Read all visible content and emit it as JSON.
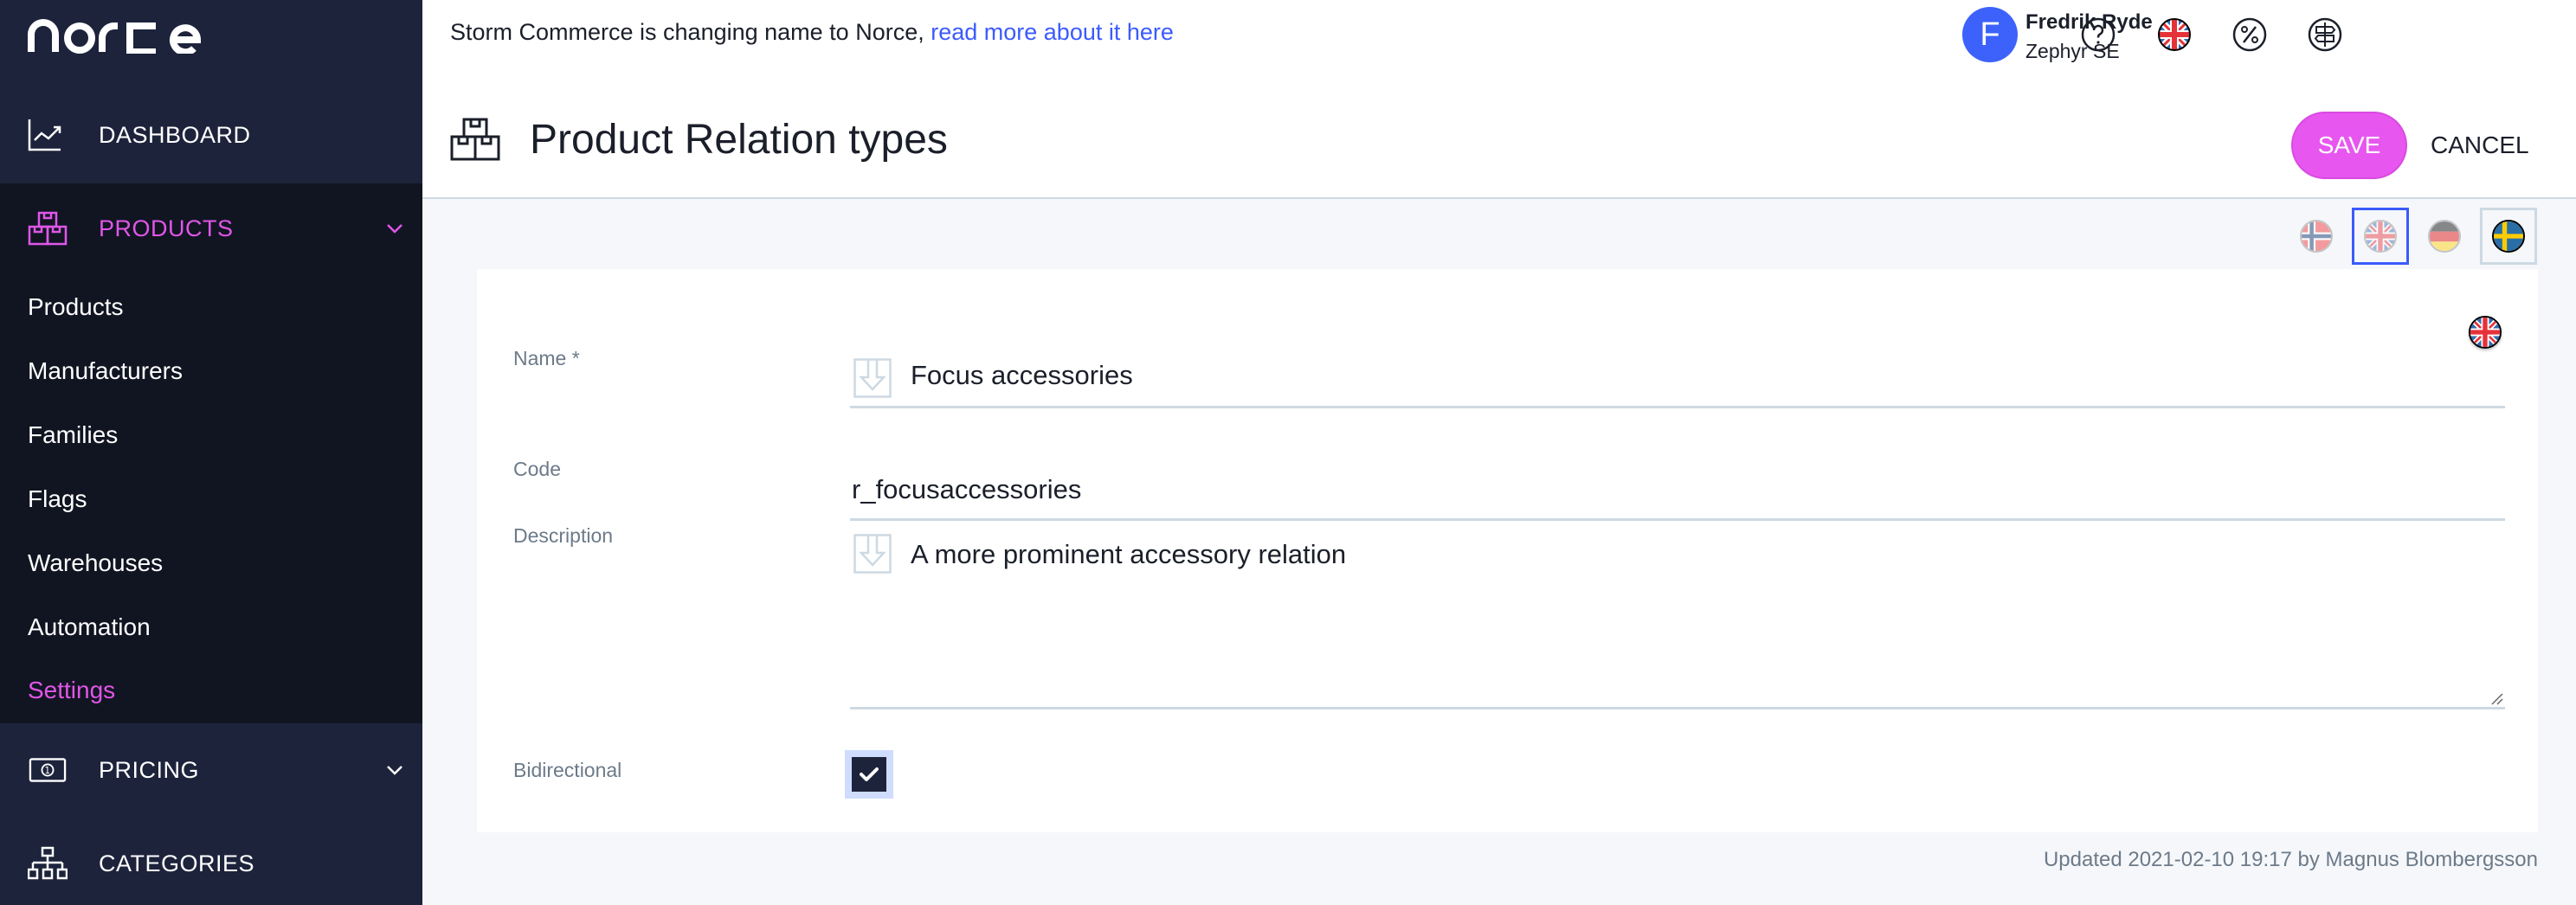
{
  "brand": {
    "logo_text": "norce",
    "accent": "#e056e8",
    "link": "#3b5bfd"
  },
  "sidebar": {
    "main_items": [
      {
        "label": "DASHBOARD",
        "icon": "chart-line-icon"
      },
      {
        "label": "PRODUCTS",
        "icon": "boxes-icon",
        "expanded": true,
        "active": true
      },
      {
        "label": "PRICING",
        "icon": "banknote-icon",
        "expanded": false
      },
      {
        "label": "CATEGORIES",
        "icon": "sitemap-icon"
      }
    ],
    "product_subitems": [
      {
        "label": "Products"
      },
      {
        "label": "Manufacturers"
      },
      {
        "label": "Families"
      },
      {
        "label": "Flags"
      },
      {
        "label": "Warehouses"
      },
      {
        "label": "Automation"
      },
      {
        "label": "Settings",
        "active": true
      }
    ]
  },
  "topbar": {
    "notice_text": "Storm Commerce is changing name to Norce,",
    "notice_link": "read more about it here",
    "icons": [
      "help-icon",
      "language-uk-flag-icon",
      "percent-icon",
      "signpost-icon"
    ],
    "user": {
      "initial": "F",
      "name": "Fredrik Ryde",
      "org": "Zephyr SE"
    }
  },
  "header": {
    "title": "Product Relation types",
    "save_label": "SAVE",
    "cancel_label": "CANCEL"
  },
  "languages": [
    {
      "code": "no",
      "name": "Norwegian",
      "selected": false
    },
    {
      "code": "en",
      "name": "English",
      "selected": true
    },
    {
      "code": "de",
      "name": "German",
      "selected": false
    },
    {
      "code": "sv",
      "name": "Swedish",
      "selected": false,
      "default": true
    }
  ],
  "form": {
    "name_label": "Name *",
    "name_value": "Focus accessories",
    "code_label": "Code",
    "code_value": "r_focusaccessories",
    "description_label": "Description",
    "description_value": "A more prominent accessory relation",
    "bidirectional_label": "Bidirectional",
    "bidirectional_checked": true
  },
  "footer": {
    "updated_text": "Updated 2021-02-10 19:17 by Magnus Blombergsson"
  }
}
